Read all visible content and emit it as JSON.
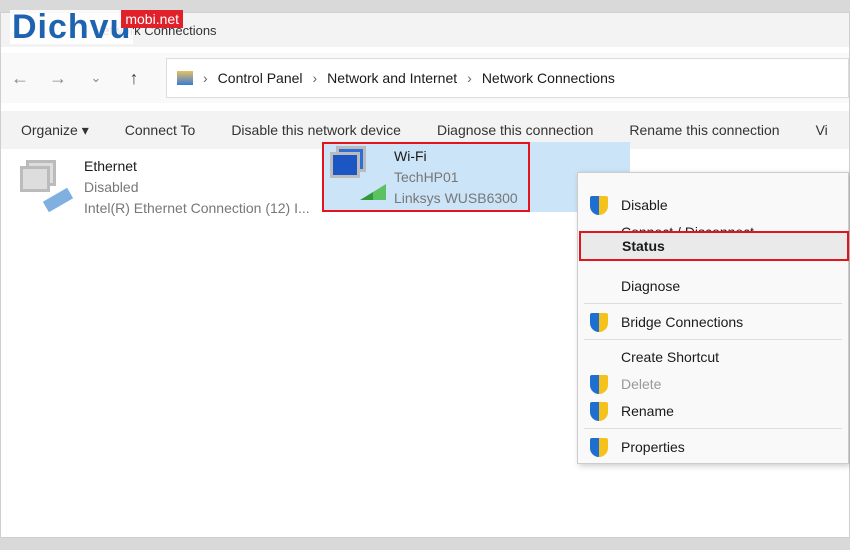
{
  "watermark": {
    "brand": "Dichvu",
    "suffix": "mobi.net"
  },
  "window": {
    "title": "Network Connections"
  },
  "breadcrumb": [
    "Control Panel",
    "Network and Internet",
    "Network Connections"
  ],
  "toolbar": [
    "Organize ▾",
    "Connect To",
    "Disable this network device",
    "Diagnose this connection",
    "Rename this connection",
    "Vi"
  ],
  "connections": [
    {
      "name": "Ethernet",
      "status": "Disabled",
      "device": "Intel(R) Ethernet Connection (12) I..."
    },
    {
      "name": "Wi-Fi",
      "status": "TechHP01",
      "device": "Linksys WUSB6300"
    }
  ],
  "context_menu": [
    {
      "label": "Disable",
      "shield": true
    },
    {
      "label": "Connect / Disconnect"
    },
    {
      "label": "Status",
      "bold": true
    },
    {
      "label": "Diagnose"
    },
    {
      "label": "Bridge Connections",
      "shield": true
    },
    {
      "label": "Create Shortcut"
    },
    {
      "label": "Delete",
      "shield": true,
      "disabled": true
    },
    {
      "label": "Rename",
      "shield": true
    },
    {
      "label": "Properties",
      "shield": true
    }
  ],
  "colors": {
    "highlight": "#e3141c",
    "selection": "#cce4f7"
  }
}
